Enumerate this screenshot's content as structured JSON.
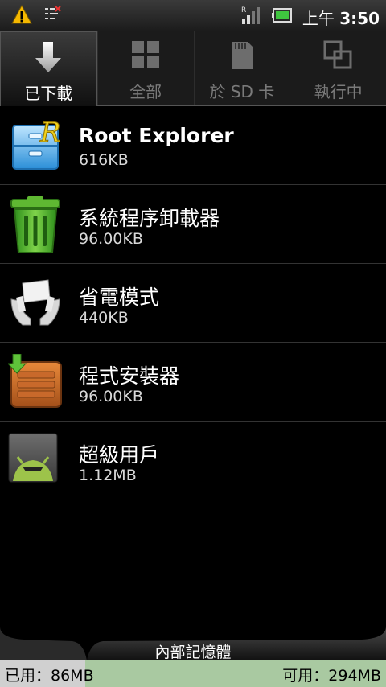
{
  "status_bar": {
    "time_prefix": "上午",
    "time": "3:50"
  },
  "tabs": [
    {
      "label": "已下載",
      "icon": "download-arrow-icon",
      "active": true
    },
    {
      "label": "全部",
      "icon": "grid-icon",
      "active": false
    },
    {
      "label": "於 SD 卡",
      "icon": "sd-card-icon",
      "active": false
    },
    {
      "label": "執行中",
      "icon": "running-windows-icon",
      "active": false
    }
  ],
  "apps": [
    {
      "name": "Root Explorer",
      "size": "616KB",
      "icon": "root-explorer-icon"
    },
    {
      "name": "系統程序卸載器",
      "size": "96.00KB",
      "icon": "trash-can-icon"
    },
    {
      "name": "省電模式",
      "size": "440KB",
      "icon": "power-saver-hands-icon"
    },
    {
      "name": "程式安裝器",
      "size": "96.00KB",
      "icon": "installer-box-icon"
    },
    {
      "name": "超級用戶",
      "size": "1.12MB",
      "icon": "superuser-android-icon"
    }
  ],
  "storage": {
    "title": "內部記憶體",
    "used": "已用：86MB",
    "free": "可用：294MB",
    "used_fraction": 0.22
  },
  "colors": {
    "used_bar": "#d0d0d0",
    "free_bar": "#a9c9a1"
  }
}
